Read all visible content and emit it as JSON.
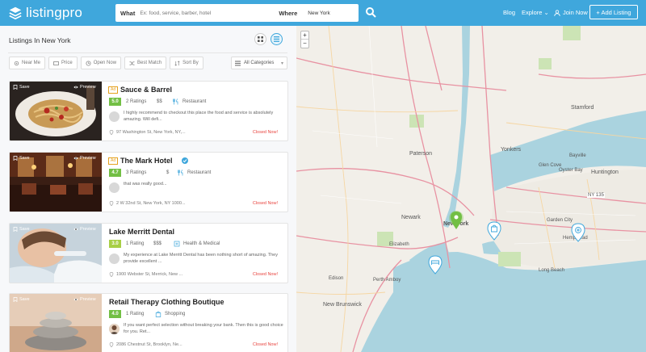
{
  "header": {
    "logo_text": "listingpro",
    "search_what_label": "What",
    "search_what_placeholder": "Ex: food, service, barber, hotel",
    "search_where_label": "Where",
    "search_where_value": "New York",
    "nav_blog": "Blog",
    "nav_explore": "Explore",
    "nav_join": "Join Now",
    "add_listing": "+ Add Listing"
  },
  "panel": {
    "title": "Listings In New York",
    "filters": [
      "Near Me",
      "Price",
      "Open Now",
      "Best Match",
      "Sort By"
    ],
    "category_select": "All Categories"
  },
  "listings": [
    {
      "ad": "Ad",
      "title": "Sauce & Barrel",
      "verified": false,
      "rating": "5.0",
      "rating_color": "#72bf44",
      "rating_count": "2 Ratings",
      "price": "$$",
      "category": "Restaurant",
      "review": "I highly recommend to checkout this place the food and service is absolutely amazing. Will defi...",
      "address": "97 Washington St, New York, NY,...",
      "status": "Closed Now!",
      "save": "Save",
      "preview": "Preview"
    },
    {
      "ad": "Ad",
      "title": "The Mark Hotel",
      "verified": true,
      "rating": "4.7",
      "rating_color": "#72bf44",
      "rating_count": "3 Ratings",
      "price": "$",
      "category": "Restaurant",
      "review": "that was really good...",
      "address": "2 W 32nd St, New York, NY 1000...",
      "status": "Closed Now!",
      "save": "Save",
      "preview": "Preview"
    },
    {
      "ad": "",
      "title": "Lake Merritt Dental",
      "verified": false,
      "rating": "3.0",
      "rating_color": "#a8cf45",
      "rating_count": "1 Rating",
      "price": "$$$",
      "category": "Health & Medical",
      "review": "My experience at Lake Merritt Dental has been nothing short of amazing. They provide excellent ...",
      "address": "1900 Webster St, Merrick, New ...",
      "status": "Closed Now!",
      "save": "Save",
      "preview": "Preview"
    },
    {
      "ad": "",
      "title": "Retail Therapy Clothing Boutique",
      "verified": false,
      "rating": "4.0",
      "rating_color": "#72bf44",
      "rating_count": "1 Rating",
      "price": "",
      "category": "Shopping",
      "review": "If you want perfect selection without breaking your bank. Then this is good choice for you. Ret...",
      "address": "2086 Chestnut St, Brooklyn, Ne...",
      "status": "Closed Now!",
      "save": "Save",
      "preview": "Preview"
    }
  ],
  "map": {
    "zoom_in": "+",
    "zoom_out": "−",
    "labels": [
      "Paterson",
      "Yonkers",
      "Stamford",
      "Huntington",
      "Newark",
      "New Brunswick",
      "New York",
      "Bayville",
      "Oyster Bay",
      "Glen Cove",
      "NY 135",
      "Garden City",
      "Hempstead",
      "Long Beach",
      "Elizabeth",
      "Edison",
      "Perth Amboy"
    ],
    "colors": {
      "water": "#aad3df",
      "land": "#f2efe9",
      "marker_green": "#72bf44",
      "marker_blue": "#3fa7dc"
    }
  }
}
